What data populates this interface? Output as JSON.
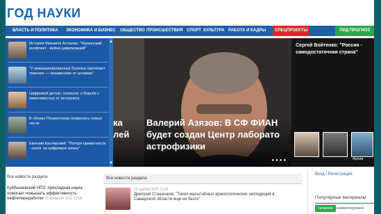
{
  "site": {
    "logo": "ГОД НАУКИ"
  },
  "nav": {
    "items": [
      "ВЛАСТЬ И ПОЛИТИКА",
      "ЭКОНОМИКА И БИЗНЕС",
      "ОБЩЕСТВО",
      "ПРОИСШЕСТВИЯ",
      "СПОРТ",
      "КУЛЬТУРА",
      "РАБОТА И КАДРЫ"
    ],
    "special": "СПЕЦПРОЕКТЫ",
    "green": "ПИД ПРОГНОЗ"
  },
  "sidebar": {
    "items": [
      {
        "text": "История Михаила Алтаева: \"Украинский конфликт - война цивилизаций\""
      },
      {
        "text": "\"У невакцинированных болезнь протекает тяжелее — независимо от штамма\""
      },
      {
        "text": "Цифровой детокс: психолог о борьбе с зависимостью от интернета"
      },
      {
        "text": "В облаке Похвистнева появились новые части"
      },
      {
        "text": "Евгений Касперский: \"Потеря приватности - налог на цифровую жизнь\""
      }
    ]
  },
  "hero": {
    "title": "Валерий Азязов: В СФ ФИАН будет создан Центр лаборато астрофизики",
    "frag1": "ка",
    "frag2": "лей"
  },
  "right": {
    "title": "Сергей Войтенко: \"Россия - самодостаточная страна\"",
    "caption": "Архив"
  },
  "sections": {
    "left_head": "Все новости раздела",
    "left_news": "Куйбышевский НПЗ: прикладная наука помогает повышать эффективность нефтепереработки",
    "left_date": "09 февраля 2022 10:00",
    "box_head": "Все новости раздела",
    "news_date": "12 ноября 2021 11:56",
    "news_text": "Дмитрий Сташенков: \"Таких масштабных археологических экспедиций в Самарской области еще не было\""
  },
  "aside": {
    "reg": "Вход / Регистрация",
    "pop_head": "Популярные материалы",
    "tab_on": "читаемое",
    "tab_off": "комментируемое"
  },
  "colors": {
    "nav": "#1f5fa6",
    "special": "#d72b2b",
    "green": "#2ea64a",
    "frame": "#0d5f66"
  }
}
